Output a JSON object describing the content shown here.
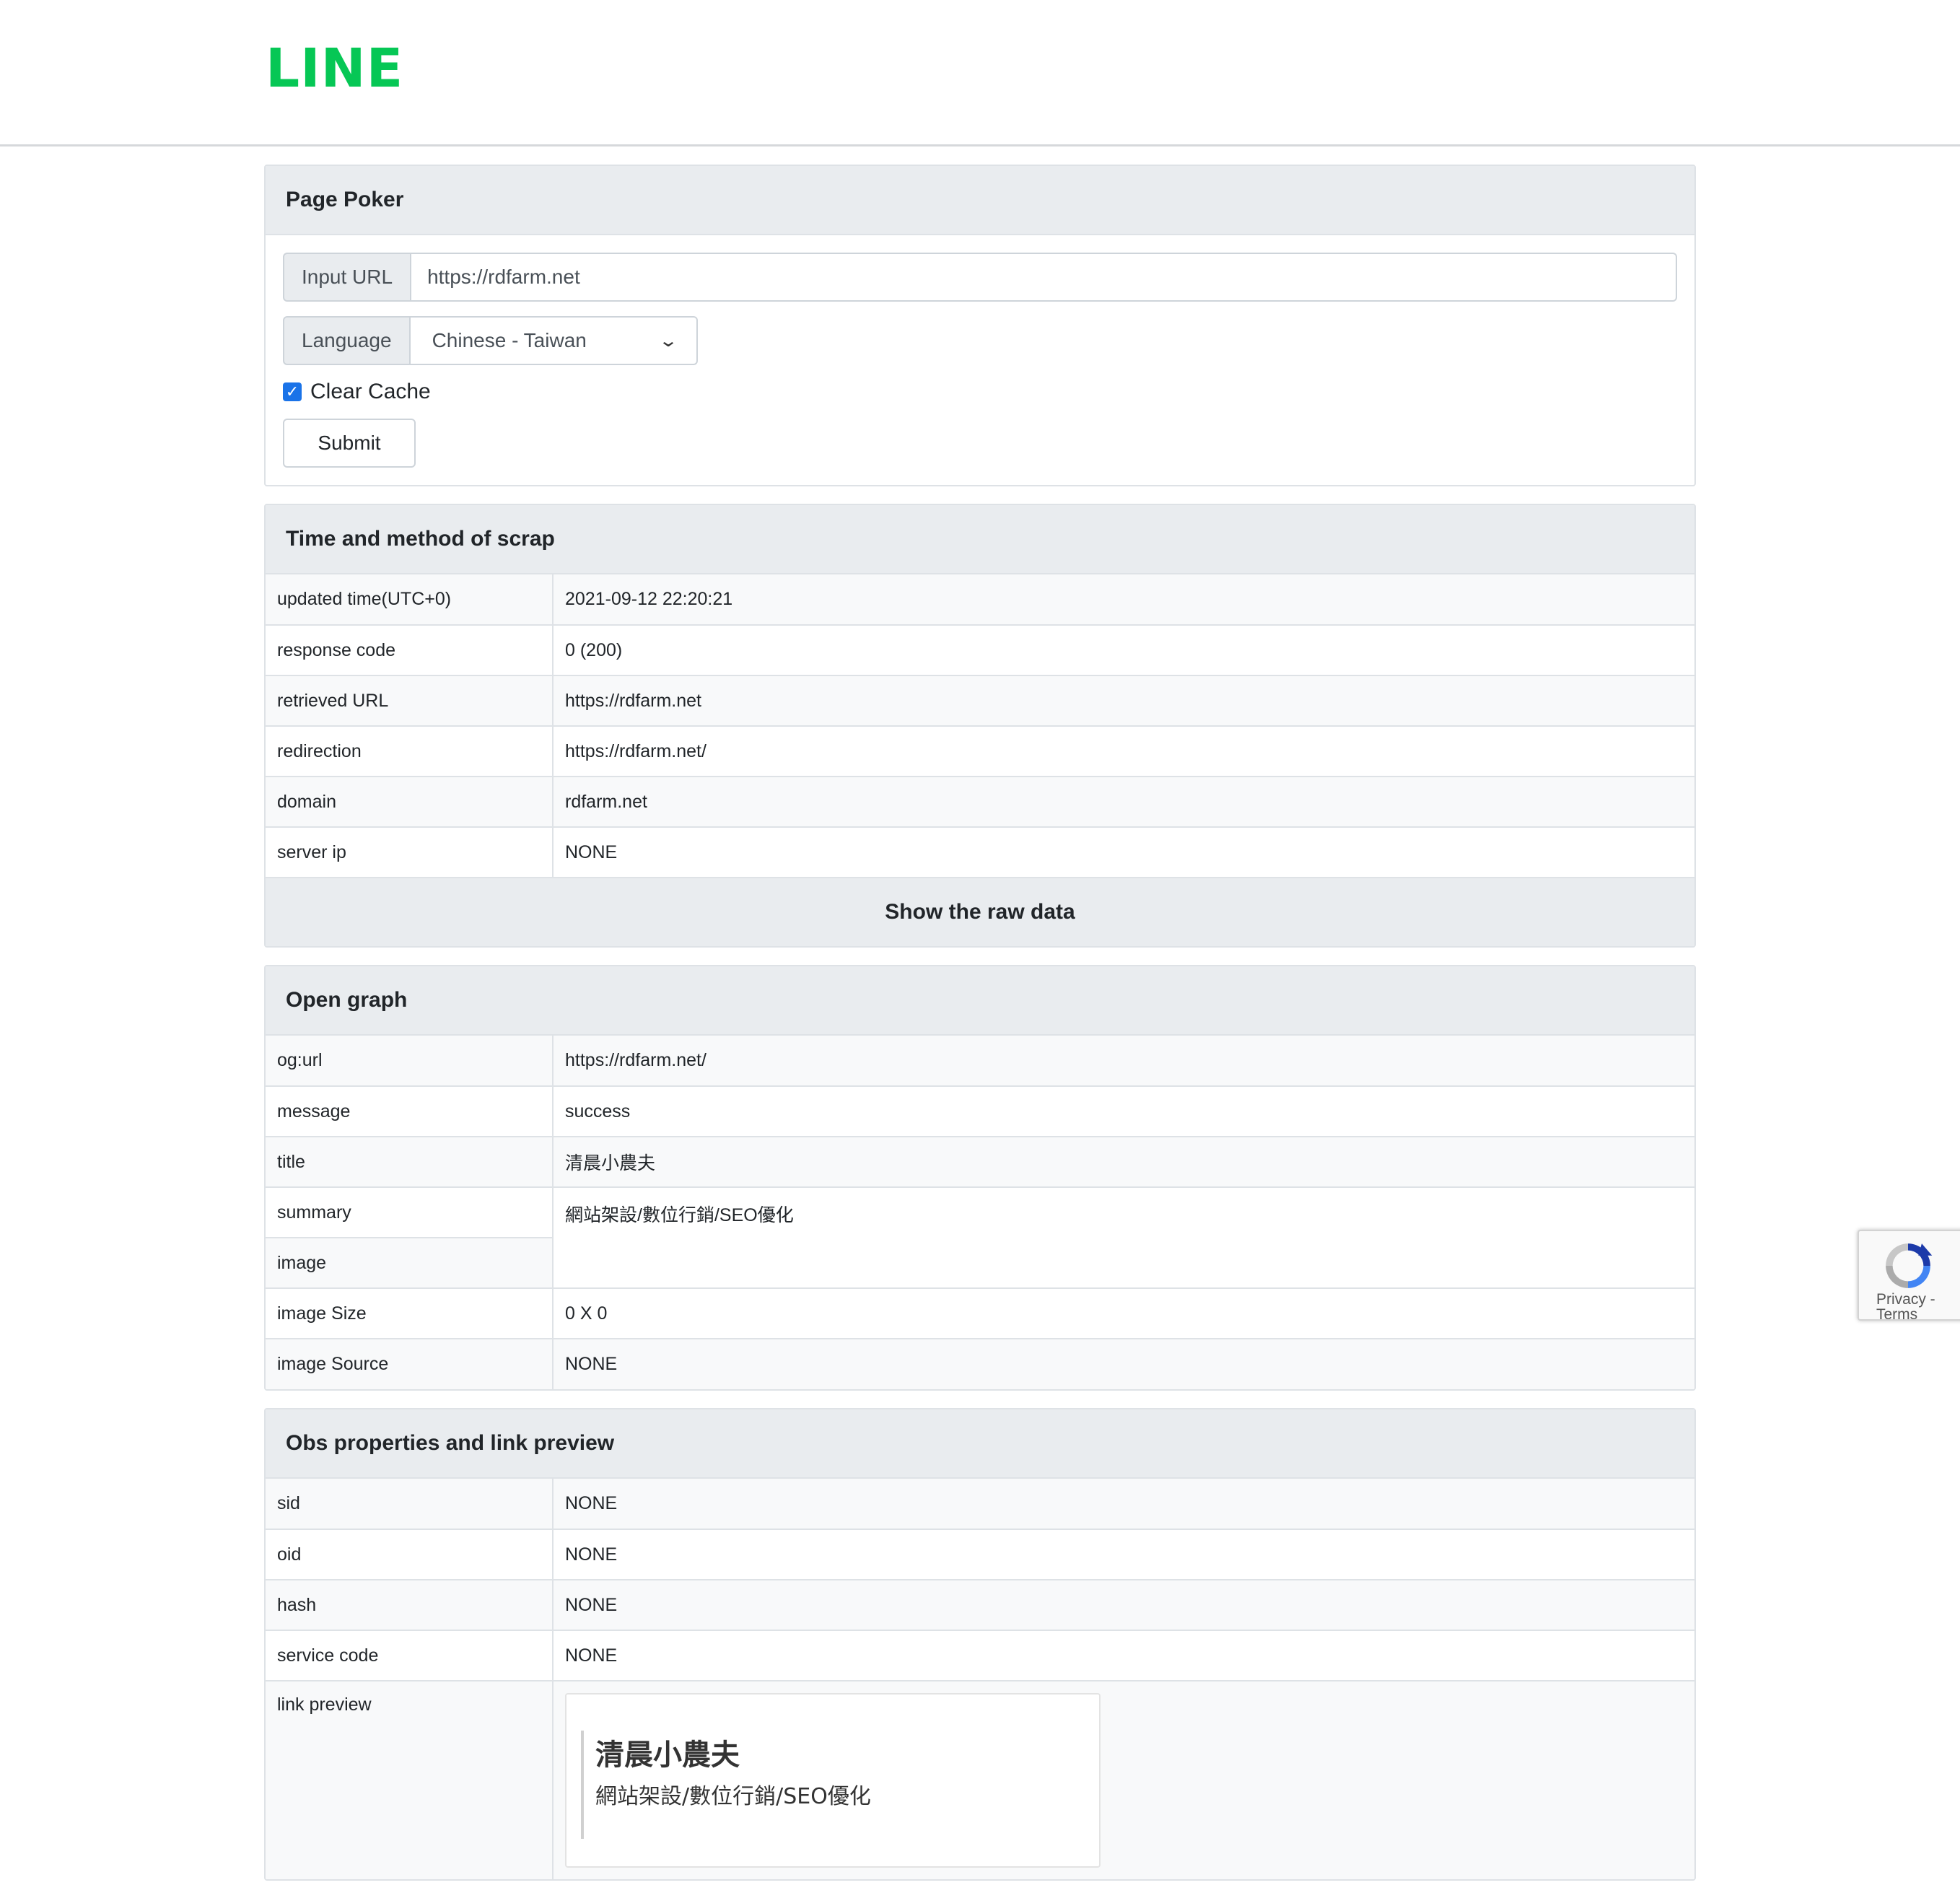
{
  "brand": {
    "logo_text": "LINE",
    "color": "#06c755"
  },
  "form": {
    "title": "Page Poker",
    "url_label": "Input URL",
    "url_value": "https://rdfarm.net",
    "language_label": "Language",
    "language_value": "Chinese - Taiwan",
    "clear_cache_label": "Clear Cache",
    "clear_cache_checked": true,
    "submit_label": "Submit"
  },
  "scrap": {
    "title": "Time and method of scrap",
    "rows": [
      {
        "key": "updated time(UTC+0)",
        "value": "2021-09-12 22:20:21"
      },
      {
        "key": "response code",
        "value": "0 (200)"
      },
      {
        "key": "retrieved URL",
        "value": "https://rdfarm.net"
      },
      {
        "key": "redirection",
        "value": "https://rdfarm.net/"
      },
      {
        "key": "domain",
        "value": "rdfarm.net"
      },
      {
        "key": "server ip",
        "value": "NONE"
      }
    ],
    "raw_button": "Show the raw data"
  },
  "og": {
    "title": "Open graph",
    "rows": [
      {
        "key": "og:url",
        "value": "https://rdfarm.net/"
      },
      {
        "key": "message",
        "value": "success"
      },
      {
        "key": "title",
        "value": "清晨小農夫"
      },
      {
        "key": "summary",
        "value": "網站架設/數位行銷/SEO優化"
      },
      {
        "key": "image",
        "value": ""
      },
      {
        "key": "image Size",
        "value": "0 X 0"
      },
      {
        "key": "image Source",
        "value": "NONE"
      }
    ]
  },
  "obs": {
    "title": "Obs properties and link preview",
    "rows": [
      {
        "key": "sid",
        "value": "NONE"
      },
      {
        "key": "oid",
        "value": "NONE"
      },
      {
        "key": "hash",
        "value": "NONE"
      },
      {
        "key": "service code",
        "value": "NONE"
      },
      {
        "key": "link preview",
        "value": ""
      }
    ],
    "preview": {
      "title": "清晨小農夫",
      "description": "網站架設/數位行銷/SEO優化"
    }
  },
  "recaptcha": {
    "text": "Privacy - Terms"
  }
}
